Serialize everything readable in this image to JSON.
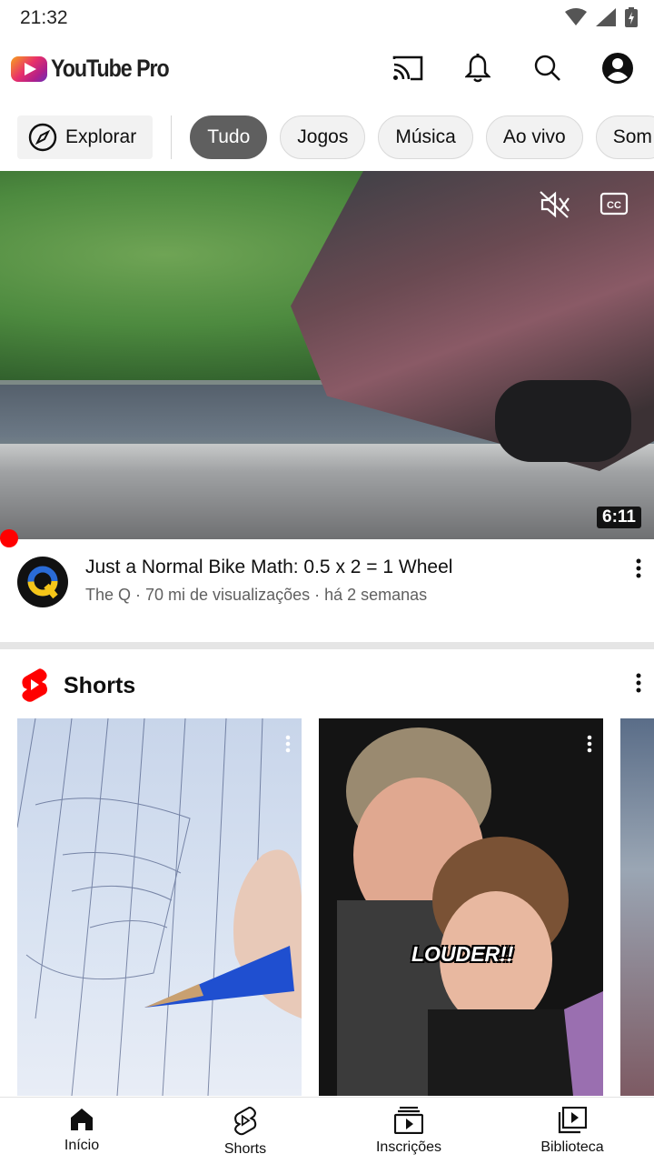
{
  "status_bar": {
    "time": "21:32",
    "icons": [
      "wifi-icon",
      "signal-icon",
      "battery-charging-icon"
    ]
  },
  "app_bar": {
    "logo_text": "YouTube Pro",
    "actions": [
      "cast-icon",
      "notifications-icon",
      "search-icon",
      "account-icon"
    ]
  },
  "chips": {
    "explore_label": "Explorar",
    "items": [
      {
        "label": "Tudo",
        "active": true
      },
      {
        "label": "Jogos",
        "active": false
      },
      {
        "label": "Música",
        "active": false
      },
      {
        "label": "Ao vivo",
        "active": false
      },
      {
        "label": "Som",
        "active": false
      }
    ]
  },
  "featured_video": {
    "duration": "6:11",
    "title": "Just a Normal Bike Math: 0.5 x 2 = 1 Wheel",
    "subtitle": "The Q · 70 mi de visualizações · há 2 semanas",
    "channel_avatar_letter": "Q",
    "overlay_icons": [
      "mute-icon",
      "closed-captions-icon"
    ]
  },
  "shorts": {
    "title": "Shorts",
    "items": [
      {
        "overlay_text": ""
      },
      {
        "overlay_text": "LOUDER!!"
      },
      {
        "overlay_text": ""
      }
    ]
  },
  "bottom_nav": {
    "items": [
      {
        "label": "Início",
        "icon": "home-icon"
      },
      {
        "label": "Shorts",
        "icon": "shorts-icon"
      },
      {
        "label": "Inscrições",
        "icon": "subscriptions-icon"
      },
      {
        "label": "Biblioteca",
        "icon": "library-icon"
      }
    ]
  },
  "colors": {
    "accent": "#ff0000",
    "chip_active": "#5f5f5f",
    "chip_bg": "#f2f2f2",
    "text_secondary": "#606060"
  }
}
